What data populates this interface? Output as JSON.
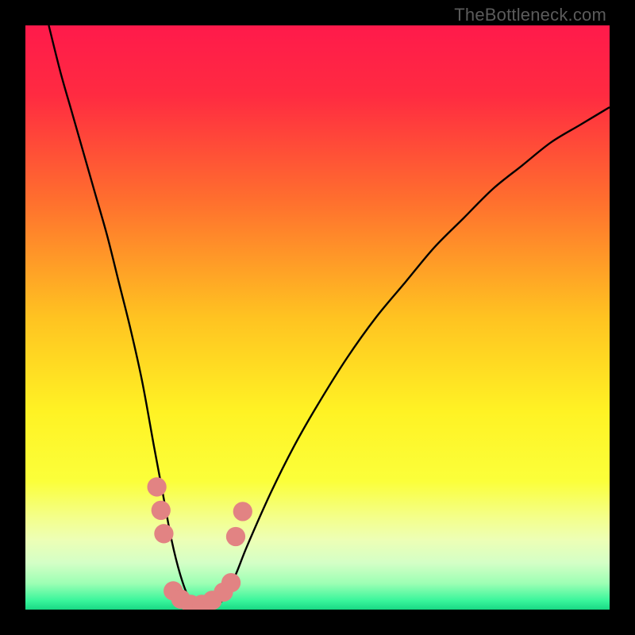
{
  "watermark": "TheBottleneck.com",
  "chart_data": {
    "type": "line",
    "title": "",
    "xlabel": "",
    "ylabel": "",
    "xlim": [
      0,
      100
    ],
    "ylim": [
      0,
      100
    ],
    "grid": false,
    "legend": false,
    "background_gradient": {
      "stops": [
        {
          "pos": 0.0,
          "color": "#ff1a4b"
        },
        {
          "pos": 0.12,
          "color": "#ff2b41"
        },
        {
          "pos": 0.3,
          "color": "#ff6f2e"
        },
        {
          "pos": 0.5,
          "color": "#ffc321"
        },
        {
          "pos": 0.66,
          "color": "#fff224"
        },
        {
          "pos": 0.78,
          "color": "#fbff3a"
        },
        {
          "pos": 0.84,
          "color": "#f4ff88"
        },
        {
          "pos": 0.88,
          "color": "#edffb5"
        },
        {
          "pos": 0.92,
          "color": "#d4ffc6"
        },
        {
          "pos": 0.955,
          "color": "#9dffb4"
        },
        {
          "pos": 0.985,
          "color": "#38f59b"
        },
        {
          "pos": 1.0,
          "color": "#19d884"
        }
      ]
    },
    "series": [
      {
        "name": "bottleneck-curve",
        "color": "#000000",
        "x": [
          4,
          6,
          8,
          10,
          12,
          14,
          16,
          18,
          20,
          22,
          23.5,
          25,
          26.5,
          28,
          30,
          32,
          34,
          36,
          38,
          42,
          46,
          50,
          55,
          60,
          65,
          70,
          75,
          80,
          85,
          90,
          95,
          100
        ],
        "y": [
          100,
          92,
          85,
          78,
          71,
          64,
          56,
          48,
          39,
          28,
          20,
          12,
          6,
          2,
          0,
          0,
          2,
          6,
          11,
          20,
          28,
          35,
          43,
          50,
          56,
          62,
          67,
          72,
          76,
          80,
          83,
          86
        ]
      }
    ],
    "markers": {
      "name": "marker-dots",
      "color": "#e28383",
      "radius_pct": 1.65,
      "points": [
        {
          "x": 22.5,
          "y": 21
        },
        {
          "x": 23.2,
          "y": 17
        },
        {
          "x": 23.7,
          "y": 13
        },
        {
          "x": 25.3,
          "y": 3.2
        },
        {
          "x": 26.6,
          "y": 1.8
        },
        {
          "x": 28.3,
          "y": 0.9
        },
        {
          "x": 30.2,
          "y": 0.9
        },
        {
          "x": 32.0,
          "y": 1.6
        },
        {
          "x": 33.9,
          "y": 3.0
        },
        {
          "x": 35.2,
          "y": 4.6
        },
        {
          "x": 36.0,
          "y": 12.5
        },
        {
          "x": 37.2,
          "y": 16.8
        }
      ]
    }
  }
}
